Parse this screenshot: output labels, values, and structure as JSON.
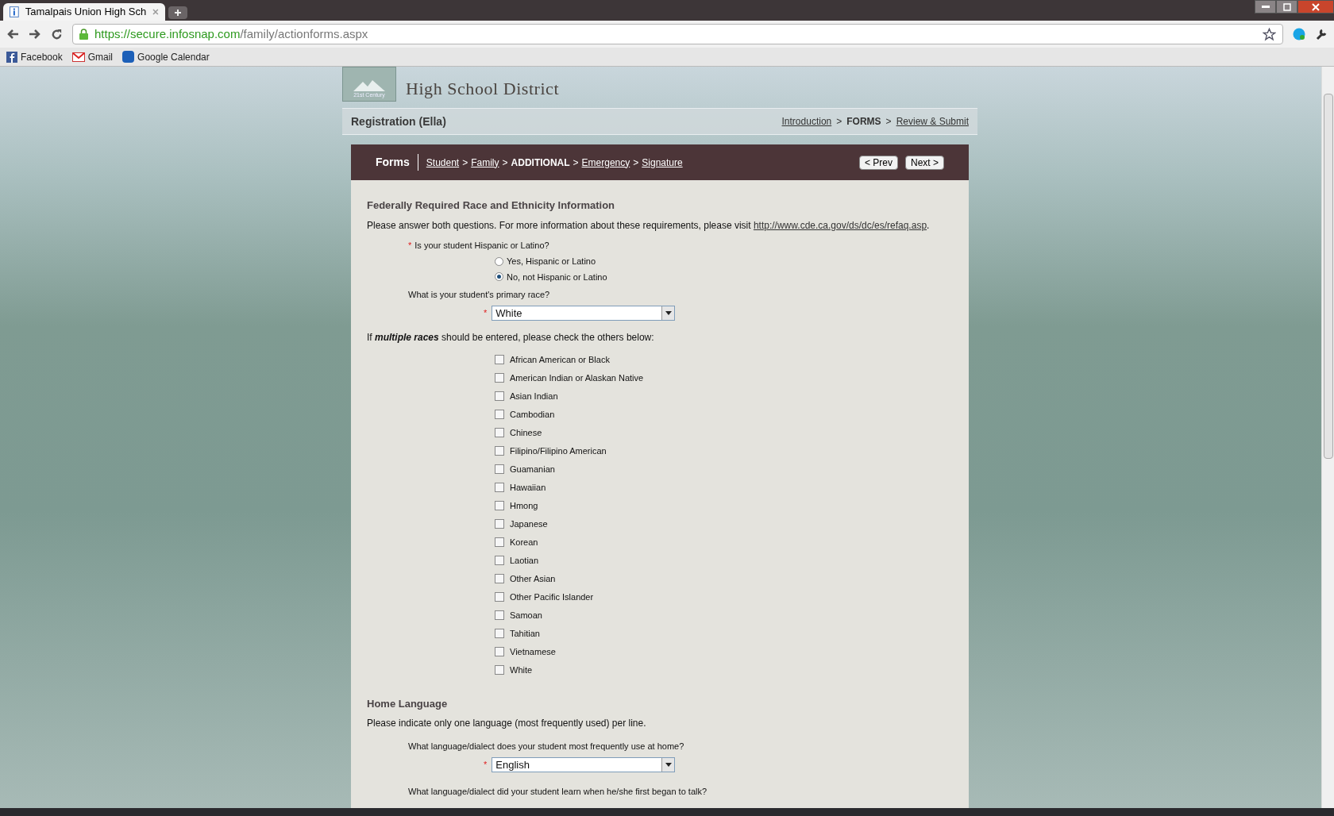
{
  "browser": {
    "tab_title": "Tamalpais Union High Sch",
    "url_host": "https://secure.infosnap.com",
    "url_path": "/family/actionforms.aspx",
    "bookmarks": [
      {
        "label": "Facebook",
        "kind": "facebook"
      },
      {
        "label": "Gmail",
        "kind": "gmail"
      },
      {
        "label": "Google Calendar",
        "kind": "calendar"
      }
    ]
  },
  "required_mark": "*",
  "header": {
    "district": "High School District",
    "badge": "21st Century"
  },
  "registration": {
    "title": "Registration (Ella)",
    "separator": ">",
    "steps": [
      {
        "label": "Introduction",
        "selected": false
      },
      {
        "label": "FORMS",
        "selected": true
      },
      {
        "label": "Review & Submit",
        "selected": false
      }
    ]
  },
  "forms_bar": {
    "title": "Forms",
    "separator": ">",
    "steps": [
      {
        "label": "Student",
        "selected": false
      },
      {
        "label": "Family",
        "selected": false
      },
      {
        "label": "ADDITIONAL",
        "selected": true
      },
      {
        "label": "Emergency",
        "selected": false
      },
      {
        "label": "Signature",
        "selected": false
      }
    ],
    "prev": "< Prev",
    "next": "Next >"
  },
  "race": {
    "heading": "Federally Required Race and Ethnicity Information",
    "intro": "Please answer both questions. For more information about these requirements, please visit",
    "link": "http://www.cde.ca.gov/ds/dc/es/refaq.asp",
    "link_end": ".",
    "hispanic_question": "Is your student Hispanic or Latino?",
    "hispanic_options": [
      {
        "label": "Yes, Hispanic or Latino",
        "selected": false
      },
      {
        "label": "No, not Hispanic or Latino",
        "selected": true
      }
    ],
    "primary_question": "What is your student's primary race?",
    "primary_value": "White",
    "multiple_note": "If *multiple races* should be entered, please check the others below:",
    "races": [
      {
        "label": "African American or Black",
        "checked": false
      },
      {
        "label": "American Indian or Alaskan Native",
        "checked": false
      },
      {
        "label": "Asian Indian",
        "checked": false
      },
      {
        "label": "Cambodian",
        "checked": false
      },
      {
        "label": "Chinese",
        "checked": false
      },
      {
        "label": "Filipino/Filipino American",
        "checked": false
      },
      {
        "label": "Guamanian",
        "checked": false
      },
      {
        "label": "Hawaiian",
        "checked": false
      },
      {
        "label": "Hmong",
        "checked": false
      },
      {
        "label": "Japanese",
        "checked": false
      },
      {
        "label": "Korean",
        "checked": false
      },
      {
        "label": "Laotian",
        "checked": false
      },
      {
        "label": "Other Asian",
        "checked": false
      },
      {
        "label": "Other Pacific Islander",
        "checked": false
      },
      {
        "label": "Samoan",
        "checked": false
      },
      {
        "label": "Tahitian",
        "checked": false
      },
      {
        "label": "Vietnamese",
        "checked": false
      },
      {
        "label": "White",
        "checked": false
      }
    ]
  },
  "language": {
    "heading": "Home Language",
    "intro": "Please indicate only one language (most frequently used) per line.",
    "home_question": "What language/dialect does your student most frequently use at home?",
    "home_value": "English",
    "first_question": "What language/dialect did your student learn when he/she first began to talk?"
  }
}
